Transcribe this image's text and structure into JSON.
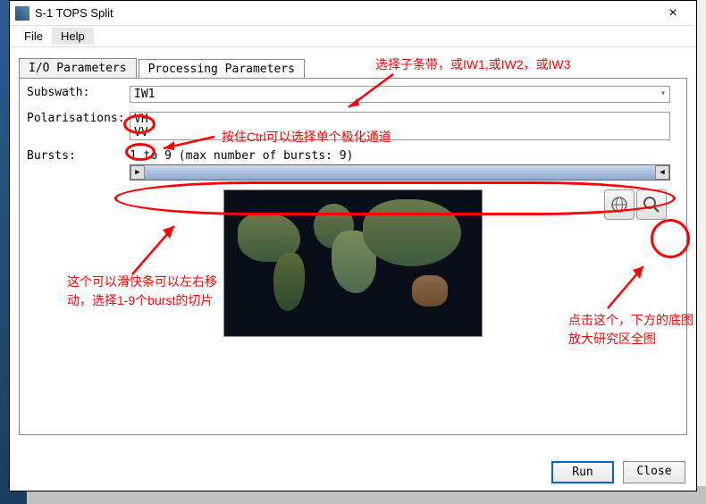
{
  "window": {
    "title": "S-1 TOPS Split",
    "close": "×"
  },
  "menu": {
    "file": "File",
    "help": "Help"
  },
  "tabs": {
    "io": "I/O Parameters",
    "processing": "Processing Parameters"
  },
  "fields": {
    "subswath_label": "Subswath:",
    "subswath_value": "IW1",
    "polarisations_label": "Polarisations:",
    "polarisations_items": [
      "VH",
      "VV"
    ],
    "bursts_label": "Bursts:",
    "bursts_text": "1 to 9 (max number of bursts: 9)"
  },
  "tools": {
    "zoom_world": "🌐",
    "zoom_in": "🔍"
  },
  "buttons": {
    "run": "Run",
    "close": "Close"
  },
  "annotations": {
    "top": "选择子条带，或IW1,或IW2，或IW3",
    "ctrl": "按住Ctrl可以选择单个极化通道",
    "slider": "这个可以滑快条可以左右移动，选择1-9个burst的切片",
    "zoom": "点击这个，下方的底图放大研究区全图"
  }
}
